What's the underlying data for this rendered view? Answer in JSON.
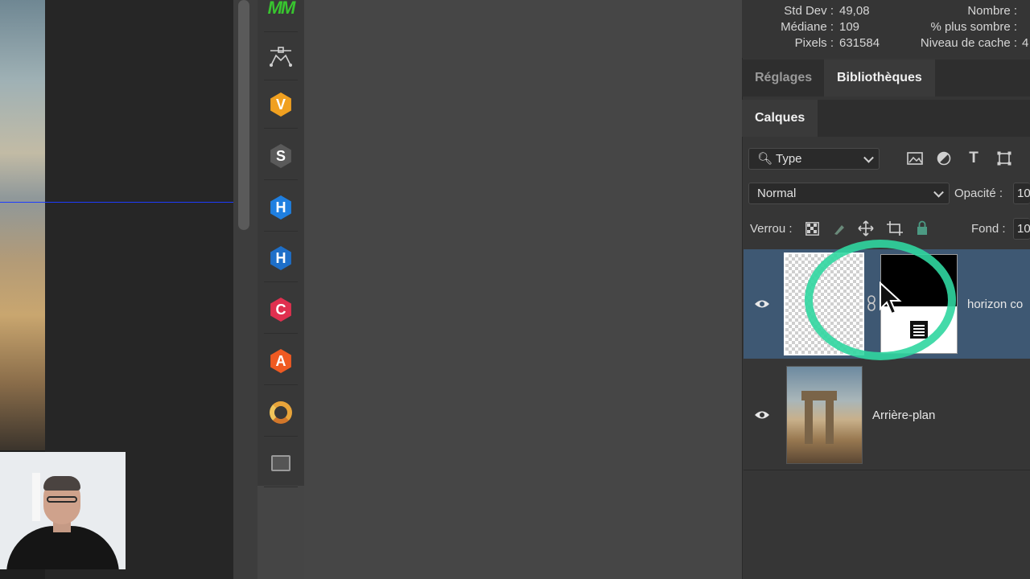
{
  "stats": {
    "std_dev_label": "Std Dev :",
    "std_dev_value": "49,08",
    "median_label": "Médiane :",
    "median_value": "109",
    "pixels_label": "Pixels :",
    "pixels_value": "631584",
    "count_label": "Nombre :",
    "darker_label": "% plus sombre :",
    "cache_label": "Niveau de cache :",
    "cache_value": "4"
  },
  "panel_tabs": {
    "adjustments": "Réglages",
    "libraries": "Bibliothèques",
    "layers": "Calques"
  },
  "layers_panel": {
    "filter_kind": "Type",
    "blend_mode": "Normal",
    "opacity_label": "Opacité :",
    "opacity_value": "10",
    "lock_label": "Verrou :",
    "fill_label": "Fond :",
    "fill_value": "10"
  },
  "layers": [
    {
      "name": "horizon co",
      "selected": true,
      "visible": true
    },
    {
      "name": "Arrière-plan",
      "selected": false,
      "visible": true
    }
  ],
  "plugins": [
    {
      "icon": "mm-icon",
      "letter": "MM"
    },
    {
      "icon": "pen-path-icon",
      "letter": ""
    },
    {
      "icon": "hex-v-icon",
      "letter": "V",
      "color": "#f0a020"
    },
    {
      "icon": "hex-s-icon",
      "letter": "S",
      "color": "#5a5a5a"
    },
    {
      "icon": "hex-h-icon",
      "letter": "H",
      "color": "#1f7fe0"
    },
    {
      "icon": "hex-h2-icon",
      "letter": "H",
      "color": "#1e6fc8"
    },
    {
      "icon": "hex-c-icon",
      "letter": "C",
      "color": "#e0304f"
    },
    {
      "icon": "hex-a-icon",
      "letter": "A",
      "color": "#ef5a22"
    },
    {
      "icon": "aperture-icon",
      "letter": ""
    },
    {
      "icon": "folder-icon",
      "letter": ""
    }
  ],
  "colors": {
    "selection": "#3e5873",
    "highlight_ring": "#30d6a0",
    "guide": "#1d3cff"
  }
}
